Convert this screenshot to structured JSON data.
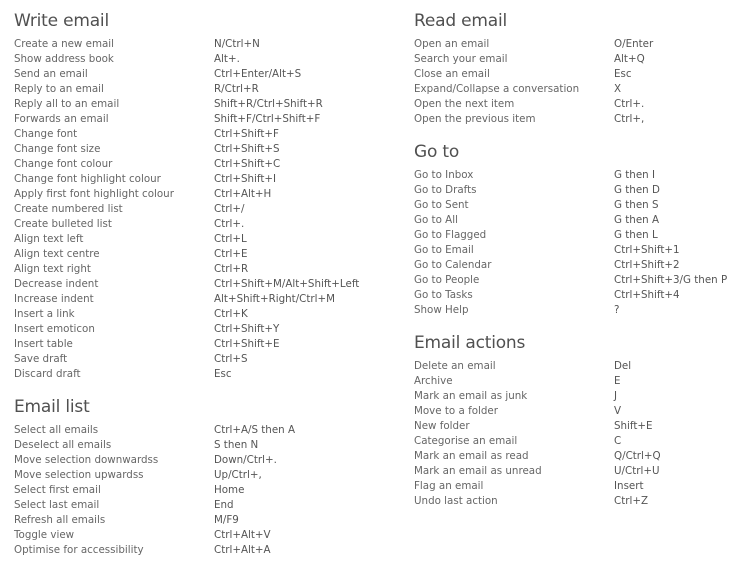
{
  "sections": {
    "write_email": {
      "title": "Write email",
      "items": [
        {
          "label": "Create a new email",
          "keys": "N/Ctrl+N"
        },
        {
          "label": "Show address book",
          "keys": "Alt+."
        },
        {
          "label": "Send an email",
          "keys": "Ctrl+Enter/Alt+S"
        },
        {
          "label": "Reply to an email",
          "keys": "R/Ctrl+R"
        },
        {
          "label": "Reply all to an email",
          "keys": "Shift+R/Ctrl+Shift+R"
        },
        {
          "label": "Forwards an email",
          "keys": "Shift+F/Ctrl+Shift+F"
        },
        {
          "label": "Change font",
          "keys": "Ctrl+Shift+F"
        },
        {
          "label": "Change font size",
          "keys": "Ctrl+Shift+S"
        },
        {
          "label": "Change font colour",
          "keys": "Ctrl+Shift+C"
        },
        {
          "label": "Change font highlight colour",
          "keys": "Ctrl+Shift+I"
        },
        {
          "label": "Apply first font highlight colour",
          "keys": "Ctrl+Alt+H"
        },
        {
          "label": "Create numbered list",
          "keys": "Ctrl+/"
        },
        {
          "label": "Create bulleted list",
          "keys": "Ctrl+."
        },
        {
          "label": "Align text left",
          "keys": "Ctrl+L"
        },
        {
          "label": "Align text centre",
          "keys": "Ctrl+E"
        },
        {
          "label": "Align text right",
          "keys": "Ctrl+R"
        },
        {
          "label": "Decrease indent",
          "keys": "Ctrl+Shift+M/Alt+Shift+Left"
        },
        {
          "label": "Increase indent",
          "keys": "Alt+Shift+Right/Ctrl+M"
        },
        {
          "label": "Insert a link",
          "keys": "Ctrl+K"
        },
        {
          "label": "Insert emoticon",
          "keys": "Ctrl+Shift+Y"
        },
        {
          "label": "Insert table",
          "keys": "Ctrl+Shift+E"
        },
        {
          "label": "Save draft",
          "keys": "Ctrl+S"
        },
        {
          "label": "Discard draft",
          "keys": "Esc"
        }
      ]
    },
    "email_list": {
      "title": "Email list",
      "items": [
        {
          "label": "Select all emails",
          "keys": "Ctrl+A/S then A"
        },
        {
          "label": "Deselect all emails",
          "keys": "S then N"
        },
        {
          "label": "Move selection downwardss",
          "keys": "Down/Ctrl+."
        },
        {
          "label": "Move selection upwardss",
          "keys": "Up/Ctrl+,"
        },
        {
          "label": "Select first email",
          "keys": "Home"
        },
        {
          "label": "Select last email",
          "keys": "End"
        },
        {
          "label": "Refresh all emails",
          "keys": "M/F9"
        },
        {
          "label": "Toggle view",
          "keys": "Ctrl+Alt+V"
        },
        {
          "label": "Optimise for accessibility",
          "keys": "Ctrl+Alt+A"
        }
      ]
    },
    "read_email": {
      "title": "Read email",
      "items": [
        {
          "label": "Open an email",
          "keys": "O/Enter"
        },
        {
          "label": "Search your email",
          "keys": "Alt+Q"
        },
        {
          "label": "Close an email",
          "keys": "Esc"
        },
        {
          "label": "Expand/Collapse a conversation",
          "keys": "X"
        },
        {
          "label": "Open the next item",
          "keys": "Ctrl+."
        },
        {
          "label": "Open the previous item",
          "keys": "Ctrl+,"
        }
      ]
    },
    "go_to": {
      "title": "Go to",
      "items": [
        {
          "label": "Go to Inbox",
          "keys": "G then I"
        },
        {
          "label": "Go to Drafts",
          "keys": "G then D"
        },
        {
          "label": "Go to Sent",
          "keys": "G then S"
        },
        {
          "label": "Go to All",
          "keys": "G then A"
        },
        {
          "label": "Go to Flagged",
          "keys": "G then L"
        },
        {
          "label": "Go to Email",
          "keys": "Ctrl+Shift+1"
        },
        {
          "label": "Go to Calendar",
          "keys": "Ctrl+Shift+2"
        },
        {
          "label": "Go to People",
          "keys": "Ctrl+Shift+3/G then P"
        },
        {
          "label": "Go to Tasks",
          "keys": "Ctrl+Shift+4"
        },
        {
          "label": "Show Help",
          "keys": "?"
        }
      ]
    },
    "email_actions": {
      "title": "Email actions",
      "items": [
        {
          "label": "Delete an email",
          "keys": "Del"
        },
        {
          "label": "Archive",
          "keys": "E"
        },
        {
          "label": "Mark an email as junk",
          "keys": "J"
        },
        {
          "label": "Move to a folder",
          "keys": "V"
        },
        {
          "label": "New folder",
          "keys": "Shift+E"
        },
        {
          "label": "Categorise an email",
          "keys": "C"
        },
        {
          "label": "Mark an email as read",
          "keys": "Q/Ctrl+Q"
        },
        {
          "label": "Mark an email as unread",
          "keys": "U/Ctrl+U"
        },
        {
          "label": "Flag an email",
          "keys": "Insert"
        },
        {
          "label": "Undo last action",
          "keys": "Ctrl+Z"
        }
      ]
    }
  }
}
